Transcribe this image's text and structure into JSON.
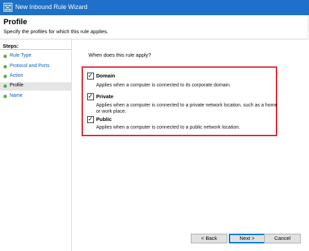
{
  "window": {
    "title": "New Inbound Rule Wizard"
  },
  "header": {
    "title": "Profile",
    "subtitle": "Specify the profiles for which this rule applies."
  },
  "steps": {
    "heading": "Steps:",
    "items": [
      {
        "label": "Rule Type",
        "current": false
      },
      {
        "label": "Protocol and Ports",
        "current": false
      },
      {
        "label": "Action",
        "current": false
      },
      {
        "label": "Profile",
        "current": true
      },
      {
        "label": "Name",
        "current": false
      }
    ]
  },
  "main": {
    "question": "When does this rule apply?",
    "options": [
      {
        "label": "Domain",
        "checked": true,
        "description": "Applies when a computer is connected to its corporate domain."
      },
      {
        "label": "Private",
        "checked": true,
        "description_line1": "Applies when a computer is connected to a private network location, such as a home",
        "description_line2": "or work place."
      },
      {
        "label": "Public",
        "checked": true,
        "description": "Applies when a computer is connected to a public network location."
      }
    ],
    "check_glyph": "✓"
  },
  "buttons": {
    "back": "< Back",
    "next": "Next >",
    "cancel": "Cancel"
  },
  "colors": {
    "titlebar": "#1e70c8",
    "highlight_box": "#e0262f",
    "step_bullet": "#58b23c",
    "step_link": "#0b5cb5"
  }
}
